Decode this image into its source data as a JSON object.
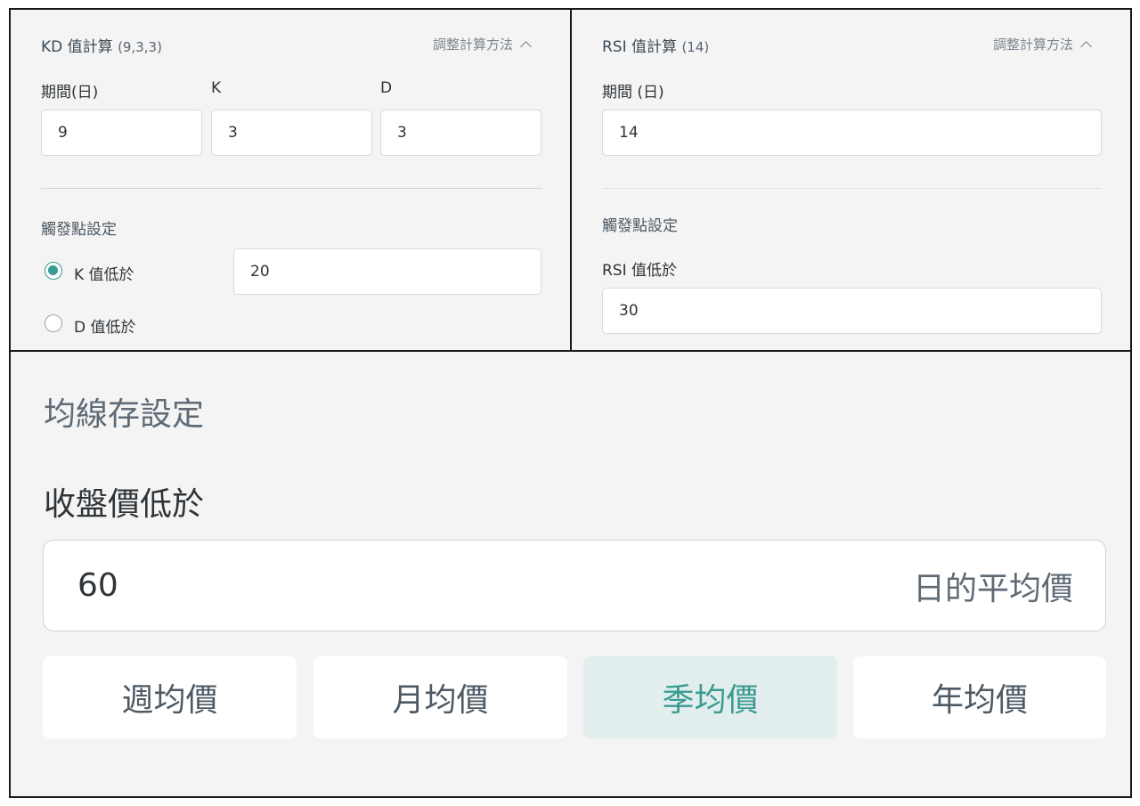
{
  "kd": {
    "title": "KD 值計算",
    "params": "(9,3,3)",
    "adjust_label": "調整計算方法",
    "labels": {
      "period": "期間(日)",
      "k": "K",
      "d": "D"
    },
    "values": {
      "period": "9",
      "k": "3",
      "d": "3"
    },
    "trigger_title": "觸發點設定",
    "options": [
      {
        "label": "K 值低於",
        "selected": true
      },
      {
        "label": "D 值低於",
        "selected": false
      }
    ],
    "threshold": "20"
  },
  "rsi": {
    "title": "RSI 值計算",
    "params": "(14)",
    "adjust_label": "調整計算方法",
    "period_label": "期間 (日)",
    "period_value": "14",
    "trigger_title": "觸發點設定",
    "threshold_label": "RSI 值低於",
    "threshold": "30"
  },
  "ma": {
    "section_title": "均線存設定",
    "label": "收盤價低於",
    "value": "60",
    "suffix": "日的平均價",
    "options": [
      {
        "label": "週均價",
        "active": false
      },
      {
        "label": "月均價",
        "active": false
      },
      {
        "label": "季均價",
        "active": true
      },
      {
        "label": "年均價",
        "active": false
      }
    ]
  },
  "colors": {
    "accent": "#3a9b92",
    "active_bg": "#e2eded",
    "panel_bg": "#f4f4f4"
  }
}
